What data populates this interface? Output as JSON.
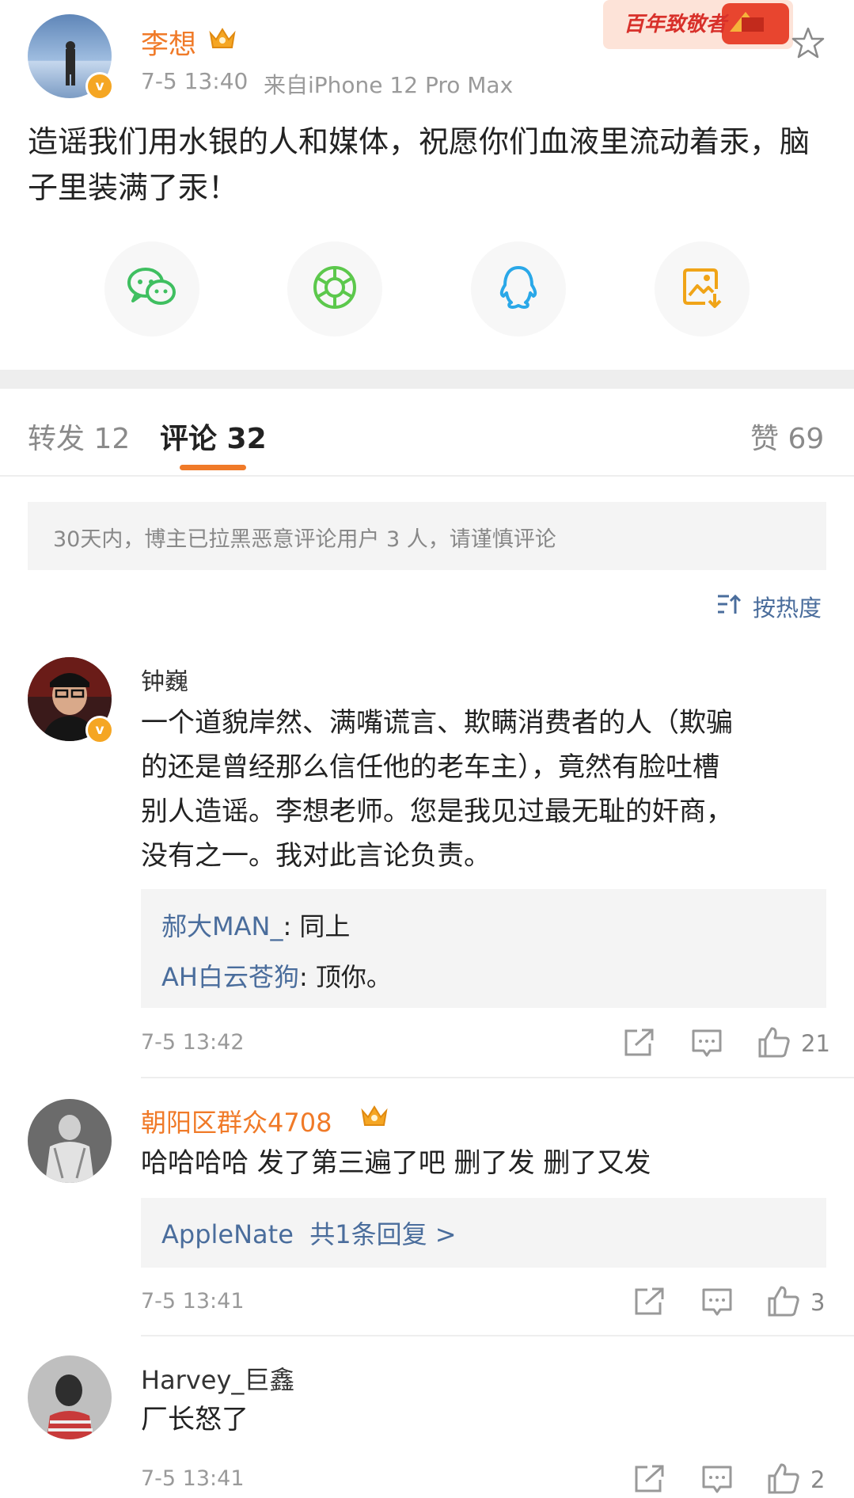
{
  "post": {
    "author": "李想",
    "time": "7-5 13:40",
    "source": "来自iPhone 12 Pro Max",
    "badge_text": "百年致敬者",
    "content": "造谣我们用水银的人和媒体，祝愿你们血液里流动着汞，脑子里装满了汞！"
  },
  "share": {
    "icons": [
      "wechat-icon",
      "moments-icon",
      "qq-icon",
      "save-image-icon"
    ]
  },
  "tabs": {
    "repost": "转发 12",
    "comments": "评论 32",
    "likes": "赞 69"
  },
  "notice": "30天内，博主已拉黑恶意评论用户 3 人，请谨慎评论",
  "sort_label": "按热度",
  "comments": [
    {
      "name": "钟巍",
      "text_lines": [
        "一个道貌岸然、满嘴谎言、欺瞒消费者的人（欺骗",
        "的还是曾经那么信任他的老车主），竟然有脸吐槽",
        "别人造谣。李想老师。您是我见过最无耻的奸商，",
        "没有之一。我对此言论负责。"
      ],
      "replies": [
        {
          "user": "郝大MAN_",
          "text": "同上"
        },
        {
          "user": "AH白云苍狗",
          "text": "顶你。"
        }
      ],
      "time": "7-5 13:42",
      "likes": "21"
    },
    {
      "name": "朝阳区群众4708",
      "text": "哈哈哈哈 发了第三遍了吧 删了发 删了又发",
      "reply_summary": "AppleNate  共1条回复 >",
      "time": "7-5 13:41",
      "likes": "3"
    },
    {
      "name": "Harvey_巨鑫",
      "text": "厂长怒了",
      "time": "7-5 13:41",
      "likes": "2"
    }
  ],
  "colors": {
    "orange": "#f07a28",
    "link": "#4a6d9c",
    "wechat": "#3fbf60",
    "moments": "#5cc84c",
    "qq": "#2aa8e8",
    "save": "#f0a418"
  }
}
